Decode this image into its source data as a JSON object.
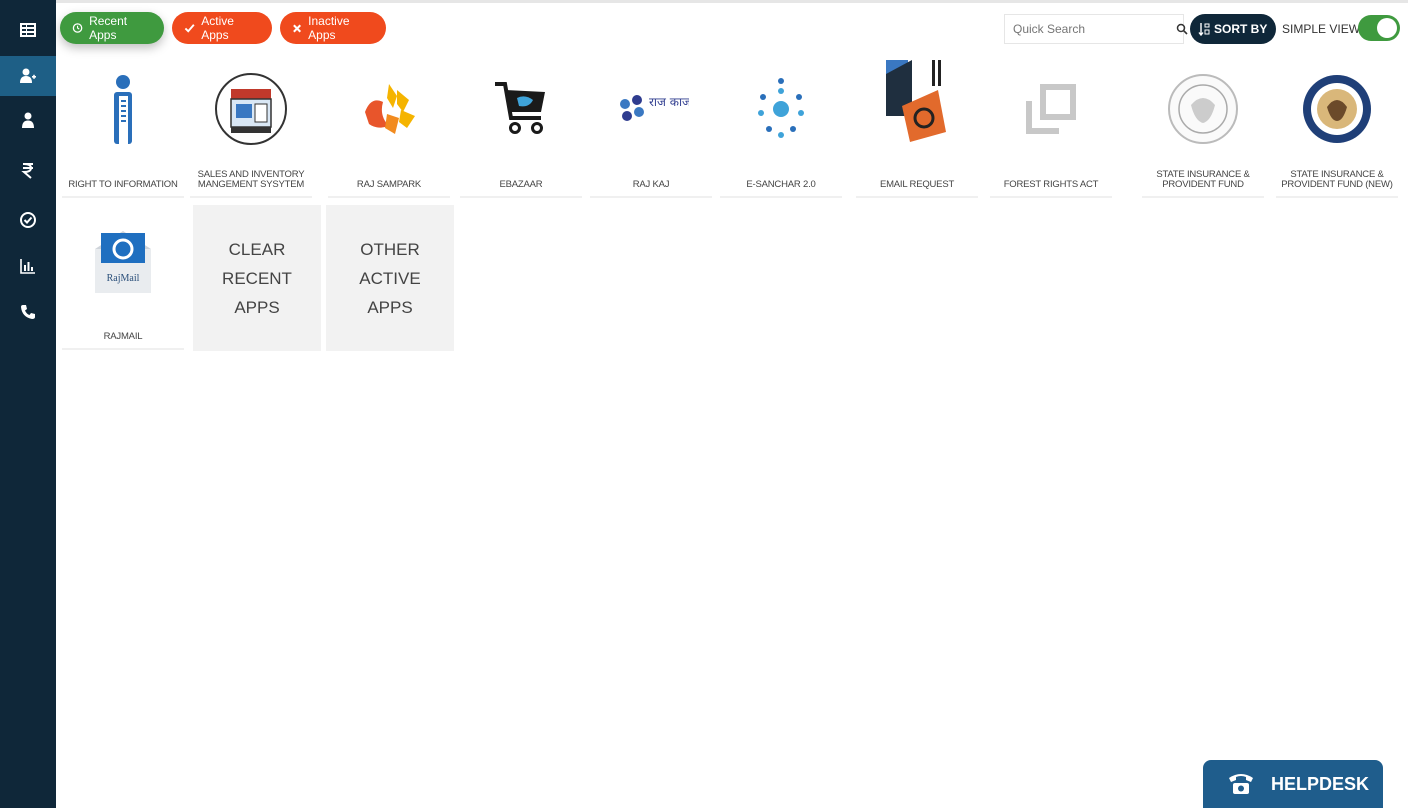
{
  "filters": {
    "recent": "Recent Apps",
    "active": "Active Apps",
    "inactive": "Inactive Apps"
  },
  "search": {
    "placeholder": "Quick Search"
  },
  "sort_label": "SORT BY",
  "simple_view_label": "SIMPLE VIEW",
  "apps": [
    {
      "label": "RIGHT TO INFORMATION",
      "icon": "info-person-icon"
    },
    {
      "label": "SALES AND INVENTORY MANGEMENT SYSYTEM",
      "icon": "inventory-store-icon"
    },
    {
      "label": "RAJ SAMPARK",
      "icon": "raj-sampark-logo-icon"
    },
    {
      "label": "EBAZAAR",
      "icon": "shopping-cart-icon"
    },
    {
      "label": "RAJ KAJ",
      "icon": "raj-kaj-logo-icon"
    },
    {
      "label": "E-SANCHAR 2.0",
      "icon": "e-sanchar-network-icon"
    },
    {
      "label": "EMAIL REQUEST",
      "icon": "email-request-icon"
    },
    {
      "label": "FOREST RIGHTS ACT",
      "icon": "window-restore-icon"
    },
    {
      "label": "STATE INSURANCE & PROVIDENT FUND",
      "icon": "state-seal-icon"
    },
    {
      "label": "STATE INSURANCE & PROVIDENT FUND (NEW)",
      "icon": "state-seal-new-icon"
    },
    {
      "label": "RAJMAIL",
      "icon": "rajmail-envelope-icon"
    }
  ],
  "rajmail_logo_text": "RajMail",
  "raj_kaj_logo_text": "राज काज",
  "actions": {
    "clear_recent": "CLEAR RECENT APPS",
    "other_active": "OTHER ACTIVE APPS"
  },
  "helpdesk_label": "HELPDESK",
  "colors": {
    "sidebar": "#0f2739",
    "sidebar_active": "#1e5f86",
    "recent_green": "#3f9a3f",
    "filter_red": "#f04a1d",
    "helpdesk_blue": "#1f5d8c"
  }
}
